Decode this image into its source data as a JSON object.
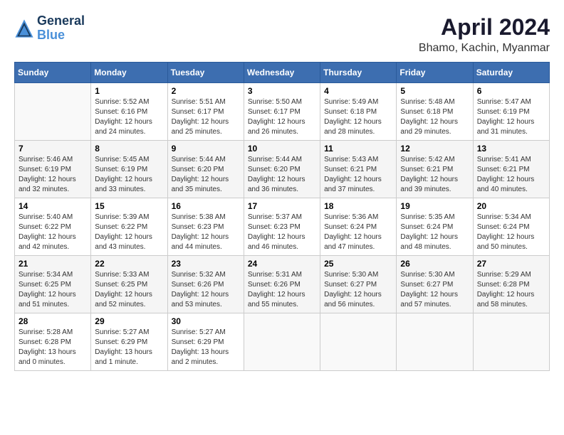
{
  "header": {
    "logo_line1": "General",
    "logo_line2": "Blue",
    "title": "April 2024",
    "subtitle": "Bhamo, Kachin, Myanmar"
  },
  "weekdays": [
    "Sunday",
    "Monday",
    "Tuesday",
    "Wednesday",
    "Thursday",
    "Friday",
    "Saturday"
  ],
  "weeks": [
    [
      {
        "day": "",
        "sunrise": "",
        "sunset": "",
        "daylight": ""
      },
      {
        "day": "1",
        "sunrise": "Sunrise: 5:52 AM",
        "sunset": "Sunset: 6:16 PM",
        "daylight": "Daylight: 12 hours and 24 minutes."
      },
      {
        "day": "2",
        "sunrise": "Sunrise: 5:51 AM",
        "sunset": "Sunset: 6:17 PM",
        "daylight": "Daylight: 12 hours and 25 minutes."
      },
      {
        "day": "3",
        "sunrise": "Sunrise: 5:50 AM",
        "sunset": "Sunset: 6:17 PM",
        "daylight": "Daylight: 12 hours and 26 minutes."
      },
      {
        "day": "4",
        "sunrise": "Sunrise: 5:49 AM",
        "sunset": "Sunset: 6:18 PM",
        "daylight": "Daylight: 12 hours and 28 minutes."
      },
      {
        "day": "5",
        "sunrise": "Sunrise: 5:48 AM",
        "sunset": "Sunset: 6:18 PM",
        "daylight": "Daylight: 12 hours and 29 minutes."
      },
      {
        "day": "6",
        "sunrise": "Sunrise: 5:47 AM",
        "sunset": "Sunset: 6:19 PM",
        "daylight": "Daylight: 12 hours and 31 minutes."
      }
    ],
    [
      {
        "day": "7",
        "sunrise": "Sunrise: 5:46 AM",
        "sunset": "Sunset: 6:19 PM",
        "daylight": "Daylight: 12 hours and 32 minutes."
      },
      {
        "day": "8",
        "sunrise": "Sunrise: 5:45 AM",
        "sunset": "Sunset: 6:19 PM",
        "daylight": "Daylight: 12 hours and 33 minutes."
      },
      {
        "day": "9",
        "sunrise": "Sunrise: 5:44 AM",
        "sunset": "Sunset: 6:20 PM",
        "daylight": "Daylight: 12 hours and 35 minutes."
      },
      {
        "day": "10",
        "sunrise": "Sunrise: 5:44 AM",
        "sunset": "Sunset: 6:20 PM",
        "daylight": "Daylight: 12 hours and 36 minutes."
      },
      {
        "day": "11",
        "sunrise": "Sunrise: 5:43 AM",
        "sunset": "Sunset: 6:21 PM",
        "daylight": "Daylight: 12 hours and 37 minutes."
      },
      {
        "day": "12",
        "sunrise": "Sunrise: 5:42 AM",
        "sunset": "Sunset: 6:21 PM",
        "daylight": "Daylight: 12 hours and 39 minutes."
      },
      {
        "day": "13",
        "sunrise": "Sunrise: 5:41 AM",
        "sunset": "Sunset: 6:21 PM",
        "daylight": "Daylight: 12 hours and 40 minutes."
      }
    ],
    [
      {
        "day": "14",
        "sunrise": "Sunrise: 5:40 AM",
        "sunset": "Sunset: 6:22 PM",
        "daylight": "Daylight: 12 hours and 42 minutes."
      },
      {
        "day": "15",
        "sunrise": "Sunrise: 5:39 AM",
        "sunset": "Sunset: 6:22 PM",
        "daylight": "Daylight: 12 hours and 43 minutes."
      },
      {
        "day": "16",
        "sunrise": "Sunrise: 5:38 AM",
        "sunset": "Sunset: 6:23 PM",
        "daylight": "Daylight: 12 hours and 44 minutes."
      },
      {
        "day": "17",
        "sunrise": "Sunrise: 5:37 AM",
        "sunset": "Sunset: 6:23 PM",
        "daylight": "Daylight: 12 hours and 46 minutes."
      },
      {
        "day": "18",
        "sunrise": "Sunrise: 5:36 AM",
        "sunset": "Sunset: 6:24 PM",
        "daylight": "Daylight: 12 hours and 47 minutes."
      },
      {
        "day": "19",
        "sunrise": "Sunrise: 5:35 AM",
        "sunset": "Sunset: 6:24 PM",
        "daylight": "Daylight: 12 hours and 48 minutes."
      },
      {
        "day": "20",
        "sunrise": "Sunrise: 5:34 AM",
        "sunset": "Sunset: 6:24 PM",
        "daylight": "Daylight: 12 hours and 50 minutes."
      }
    ],
    [
      {
        "day": "21",
        "sunrise": "Sunrise: 5:34 AM",
        "sunset": "Sunset: 6:25 PM",
        "daylight": "Daylight: 12 hours and 51 minutes."
      },
      {
        "day": "22",
        "sunrise": "Sunrise: 5:33 AM",
        "sunset": "Sunset: 6:25 PM",
        "daylight": "Daylight: 12 hours and 52 minutes."
      },
      {
        "day": "23",
        "sunrise": "Sunrise: 5:32 AM",
        "sunset": "Sunset: 6:26 PM",
        "daylight": "Daylight: 12 hours and 53 minutes."
      },
      {
        "day": "24",
        "sunrise": "Sunrise: 5:31 AM",
        "sunset": "Sunset: 6:26 PM",
        "daylight": "Daylight: 12 hours and 55 minutes."
      },
      {
        "day": "25",
        "sunrise": "Sunrise: 5:30 AM",
        "sunset": "Sunset: 6:27 PM",
        "daylight": "Daylight: 12 hours and 56 minutes."
      },
      {
        "day": "26",
        "sunrise": "Sunrise: 5:30 AM",
        "sunset": "Sunset: 6:27 PM",
        "daylight": "Daylight: 12 hours and 57 minutes."
      },
      {
        "day": "27",
        "sunrise": "Sunrise: 5:29 AM",
        "sunset": "Sunset: 6:28 PM",
        "daylight": "Daylight: 12 hours and 58 minutes."
      }
    ],
    [
      {
        "day": "28",
        "sunrise": "Sunrise: 5:28 AM",
        "sunset": "Sunset: 6:28 PM",
        "daylight": "Daylight: 13 hours and 0 minutes."
      },
      {
        "day": "29",
        "sunrise": "Sunrise: 5:27 AM",
        "sunset": "Sunset: 6:29 PM",
        "daylight": "Daylight: 13 hours and 1 minute."
      },
      {
        "day": "30",
        "sunrise": "Sunrise: 5:27 AM",
        "sunset": "Sunset: 6:29 PM",
        "daylight": "Daylight: 13 hours and 2 minutes."
      },
      {
        "day": "",
        "sunrise": "",
        "sunset": "",
        "daylight": ""
      },
      {
        "day": "",
        "sunrise": "",
        "sunset": "",
        "daylight": ""
      },
      {
        "day": "",
        "sunrise": "",
        "sunset": "",
        "daylight": ""
      },
      {
        "day": "",
        "sunrise": "",
        "sunset": "",
        "daylight": ""
      }
    ]
  ]
}
